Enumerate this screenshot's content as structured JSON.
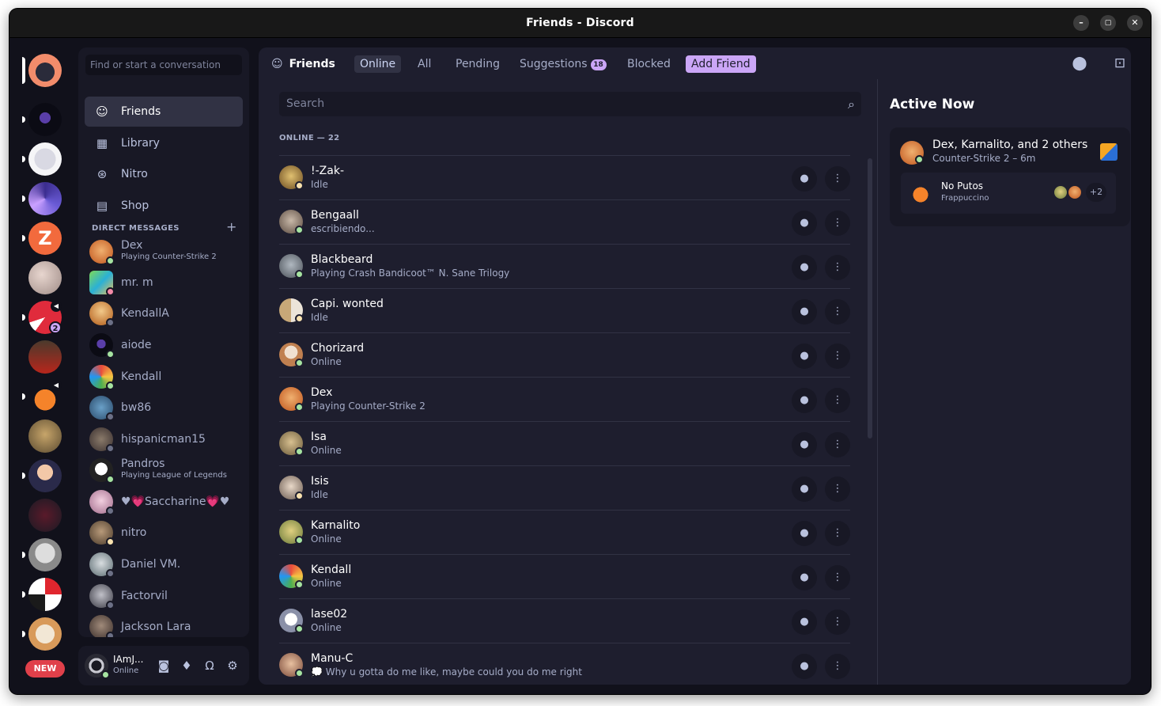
{
  "window": {
    "title": "Friends - Discord"
  },
  "rail": {
    "new_badge": "NEW",
    "mention_count": "2"
  },
  "sidebar": {
    "search_placeholder": "Find or start a conversation",
    "nav": [
      {
        "label": "Friends",
        "icon": "friends-icon"
      },
      {
        "label": "Library",
        "icon": "library-icon"
      },
      {
        "label": "Nitro",
        "icon": "nitro-icon"
      },
      {
        "label": "Shop",
        "icon": "shop-icon"
      }
    ],
    "dm_header": "DIRECT MESSAGES",
    "dms": [
      {
        "name": "Dex",
        "sub": "Playing Counter-Strike 2",
        "status": "online"
      },
      {
        "name": "mr. m",
        "sub": "",
        "status": "dnd"
      },
      {
        "name": "KendallA",
        "sub": "",
        "status": "offline"
      },
      {
        "name": "aiode",
        "sub": "",
        "status": "online"
      },
      {
        "name": "Kendall",
        "sub": "",
        "status": "online"
      },
      {
        "name": "bw86",
        "sub": "",
        "status": "offline"
      },
      {
        "name": "hispanicman15",
        "sub": "",
        "status": "offline"
      },
      {
        "name": "Pandros",
        "sub": "Playing League of Legends",
        "status": "online"
      },
      {
        "name": "♥💗Saccharine💗♥",
        "sub": "",
        "status": "offline"
      },
      {
        "name": "nitro",
        "sub": "",
        "status": "idle"
      },
      {
        "name": "Daniel VM.",
        "sub": "",
        "status": "offline"
      },
      {
        "name": "Factorvil",
        "sub": "",
        "status": "offline"
      },
      {
        "name": "Jackson Lara",
        "sub": "",
        "status": "offline"
      }
    ]
  },
  "user": {
    "name": "IAmJ...",
    "status": "Online"
  },
  "header": {
    "friends": "Friends",
    "tabs": [
      "Online",
      "All",
      "Pending",
      "Suggestions",
      "Blocked",
      "Add Friend"
    ],
    "suggestions_count": "18"
  },
  "main": {
    "search_placeholder": "Search",
    "online_header": "ONLINE — 22",
    "friends": [
      {
        "name": "!-Zak-",
        "sub": "Idle",
        "status": "idle"
      },
      {
        "name": "Bengaall",
        "sub": "escribiendo...",
        "status": "online"
      },
      {
        "name": "Blackbeard",
        "sub": "Playing Crash Bandicoot™ N. Sane Trilogy",
        "status": "online"
      },
      {
        "name": "Capi. wonted",
        "sub": "Idle",
        "status": "idle"
      },
      {
        "name": "Chorizard",
        "sub": "Online",
        "status": "online"
      },
      {
        "name": "Dex",
        "sub": "Playing Counter-Strike 2",
        "status": "online"
      },
      {
        "name": "Isa",
        "sub": "Online",
        "status": "online"
      },
      {
        "name": "Isis",
        "sub": "Idle",
        "status": "idle"
      },
      {
        "name": "Karnalito",
        "sub": "Online",
        "status": "online"
      },
      {
        "name": "Kendall",
        "sub": "Online",
        "status": "online"
      },
      {
        "name": "lase02",
        "sub": "Online",
        "status": "online"
      },
      {
        "name": "Manu-C",
        "sub": "💭 Why u gotta do me like, maybe could you do me right",
        "status": "online"
      }
    ]
  },
  "active_now": {
    "title": "Active Now",
    "card_title": "Dex, Karnalito, and 2 others",
    "card_sub": "Counter-Strike 2 – 6m",
    "voice_title": "No Putos",
    "voice_sub": "Frappuccino",
    "extra": "+2"
  },
  "colors": {
    "accent": "#cba6f7",
    "online": "#a6e3a1",
    "idle": "#f9e2af",
    "dnd": "#f38ba8"
  }
}
